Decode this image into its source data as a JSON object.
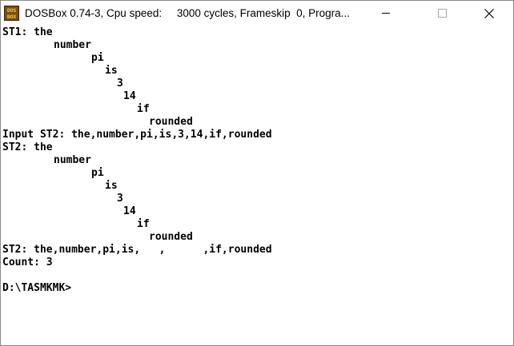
{
  "window": {
    "title": "DOSBox 0.74-3, Cpu speed:     3000 cycles, Frameskip  0, Progra...",
    "icon": {
      "name": "dosbox-icon",
      "line1": "DOS",
      "line2": "BOX"
    },
    "controls": {
      "minimize": "minimize-icon",
      "maximize": "maximize-icon",
      "close": "close-icon"
    }
  },
  "console": {
    "lines": [
      "ST1: the",
      "number",
      "pi",
      "is",
      "3",
      "14",
      "if",
      "rounded",
      "Input ST2: the,number,pi,is,3,14,if,rounded",
      "ST2: the",
      "number",
      "pi",
      "is",
      "3",
      "14",
      "if",
      "rounded",
      "ST2: the,number,pi,is,   ,      ,if,rounded",
      "Count: 3",
      "",
      "D:\\TASMKMK>"
    ]
  },
  "colors": {
    "background": "#ffffff",
    "text": "#000000",
    "icon_background": "#7a4e12",
    "icon_text": "#f0c64a"
  }
}
